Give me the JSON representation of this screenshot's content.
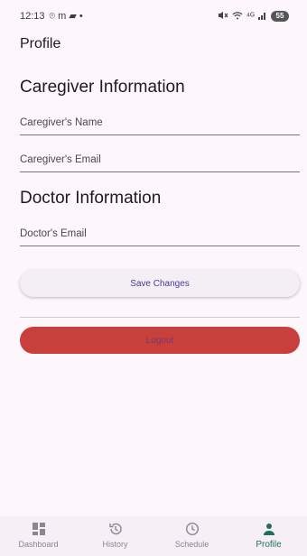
{
  "status_bar": {
    "time": "12:13",
    "notification_glyphs": "⌾ m ▰ •",
    "signal_text": "⁴ᴳ",
    "battery": "55"
  },
  "page": {
    "title": "Profile"
  },
  "caregiver": {
    "heading": "Caregiver Information",
    "name_label": "Caregiver's Name",
    "email_label": "Caregiver's Email"
  },
  "doctor": {
    "heading": "Doctor Information",
    "email_label": "Doctor's Email"
  },
  "actions": {
    "save_label": "Save Changes",
    "logout_label": "Logout"
  },
  "nav": {
    "items": [
      {
        "label": "Dashboard",
        "icon": "dashboard-icon"
      },
      {
        "label": "History",
        "icon": "history-icon"
      },
      {
        "label": "Schedule",
        "icon": "schedule-icon"
      },
      {
        "label": "Profile",
        "icon": "profile-icon"
      }
    ],
    "active": "Profile",
    "active_color": "#1f6f5c"
  },
  "colors": {
    "background": "#fdf7fc",
    "logout": "#c8403c",
    "save_text": "#4b3a9a"
  }
}
